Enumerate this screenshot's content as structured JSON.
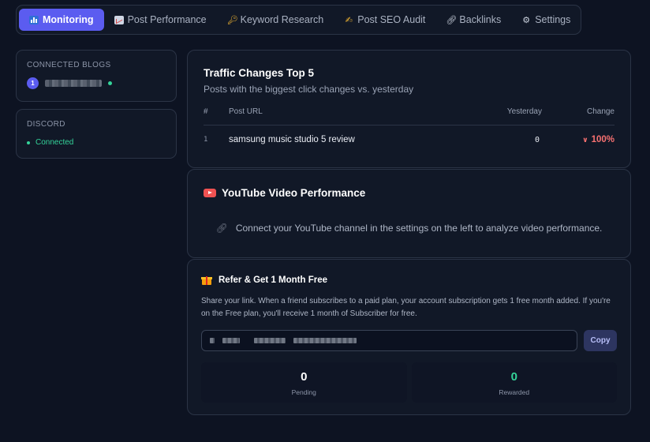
{
  "nav": {
    "tabs": [
      {
        "label": "Monitoring",
        "icon": "bar-chart-icon",
        "active": true
      },
      {
        "label": "Post Performance",
        "icon": "trend-chart-icon",
        "active": false
      },
      {
        "label": "Keyword Research",
        "icon": "key-icon",
        "active": false
      },
      {
        "label": "Post SEO Audit",
        "icon": "writing-hand-icon",
        "active": false
      },
      {
        "label": "Backlinks",
        "icon": "link-icon",
        "active": false
      },
      {
        "label": "Settings",
        "icon": "gear-icon",
        "active": false
      }
    ]
  },
  "sidebar": {
    "connected_blogs": {
      "title": "CONNECTED BLOGS",
      "items": [
        {
          "index": "1"
        }
      ]
    },
    "discord": {
      "title": "DISCORD",
      "status": "Connected"
    }
  },
  "traffic": {
    "title": "Traffic Changes Top 5",
    "subtitle": "Posts with the biggest click changes vs. yesterday",
    "columns": {
      "num": "#",
      "url": "Post URL",
      "yesterday": "Yesterday",
      "change": "Change"
    },
    "rows": [
      {
        "num": "1",
        "url": "samsung music studio 5 review",
        "yesterday": "0",
        "change": "100%"
      }
    ]
  },
  "youtube": {
    "title": "YouTube Video Performance",
    "message": "Connect your YouTube channel in the settings on the left to analyze video performance."
  },
  "referral": {
    "title": "Refer & Get 1 Month Free",
    "description": "Share your link. When a friend subscribes to a paid plan, your account subscription gets 1 free month added. If you're on the Free plan, you'll receive 1 month of Subscriber for free.",
    "copy_label": "Copy",
    "stats": [
      {
        "value": "0",
        "label": "Pending",
        "color": "#ffffff"
      },
      {
        "value": "0",
        "label": "Rewarded",
        "color": "#34d399"
      }
    ]
  },
  "colors": {
    "accent": "#5b5cf0",
    "positive": "#34d399",
    "negative": "#f87171"
  }
}
